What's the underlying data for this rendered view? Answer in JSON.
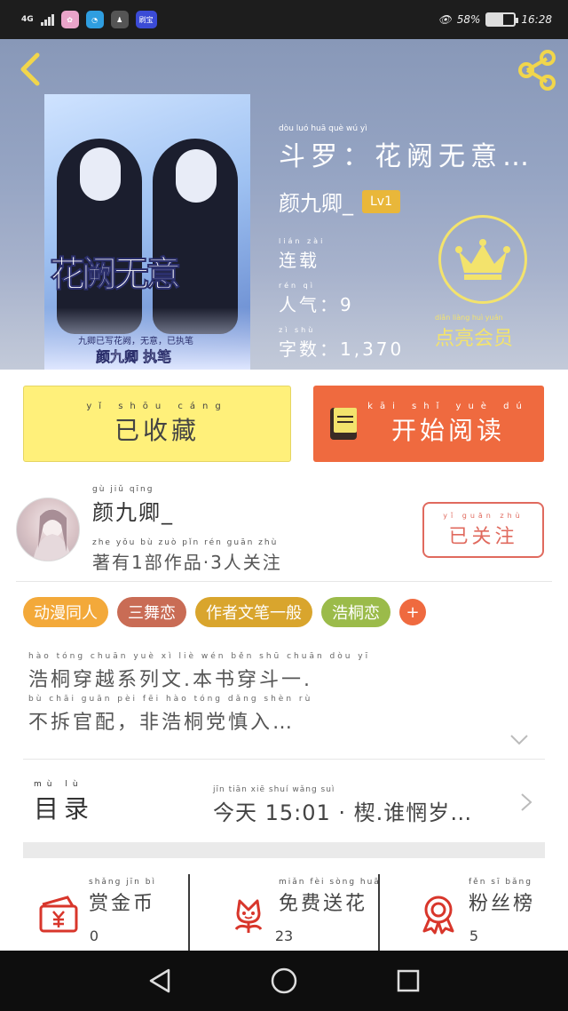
{
  "status_bar": {
    "network": "4G",
    "battery": "58%",
    "battery_level": 0.58,
    "time": "16:28",
    "app_badge": "刷宝"
  },
  "header": {
    "book_title": "斗罗：花阙无意…",
    "book_title_pinyin": "dòu luó   huā què wú yì",
    "author": "颜九卿_",
    "level": "Lv1",
    "status": "连载",
    "status_pinyin": "lián zài",
    "popularity": "人气：9",
    "popularity_pinyin": "rén qì",
    "word_count": "字数：1,370",
    "word_count_pinyin": "zì shù",
    "vip_label": "点亮会员",
    "vip_pinyin": "diǎn liàng huì yuán",
    "cover_title": "花阙无意",
    "cover_author": "颜九卿 执笔",
    "cover_small": "九卿已写花阙，无意，已执笔"
  },
  "actions": {
    "collect_label": "已收藏",
    "collect_pinyin": "yǐ shōu cáng",
    "read_label": "开始阅读",
    "read_pinyin": "kāi shǐ yuè dú"
  },
  "author_section": {
    "name": "颜九卿_",
    "name_pinyin": "gù jiǔ qīng",
    "stats": "著有1部作品·3人关注",
    "stats_pinyin": "zhe yǒu   bù zuò pǐn   rén guān zhù",
    "follow_label": "已关注",
    "follow_pinyin": "yǐ guān zhù"
  },
  "tags": [
    {
      "label": "动漫同人",
      "color": "#f3a93a"
    },
    {
      "label": "三舞恋",
      "color": "#c96c55"
    },
    {
      "label": "作者文笔一般",
      "color": "#d9a52d"
    },
    {
      "label": "浩桐恋",
      "color": "#9bbb4a"
    }
  ],
  "tag_add": "+",
  "description": {
    "line1": "浩桐穿越系列文.本书穿斗一.",
    "line2": "不拆官配，非浩桐党慎入…",
    "pinyin1": "hào tóng chuān yuè xì liè wén   běn shū chuān dòu yī",
    "pinyin2": "bù chāi guān pèi   fēi hào tóng dǎng shèn rù"
  },
  "catalog": {
    "label": "目录",
    "label_pinyin": "mù lù",
    "latest": "今天 15:01 · 楔.谁惘岁…",
    "latest_pinyin": "jīn tiān     xiē shuí wǎng suì"
  },
  "stats": [
    {
      "label": "赏金币",
      "pinyin": "shǎng jīn bì",
      "count": "0",
      "icon": "coin-envelope-icon"
    },
    {
      "label": "免费送花",
      "pinyin": "miǎn fèi sòng huā",
      "count": "23",
      "icon": "flower-icon"
    },
    {
      "label": "粉丝榜",
      "pinyin": "fěn sī bǎng",
      "count": "5",
      "icon": "medal-icon"
    }
  ],
  "colors": {
    "collect": "#fff07a",
    "read": "#ef6a3f",
    "follow": "#e06a5e",
    "vip": "#f3e36c"
  }
}
